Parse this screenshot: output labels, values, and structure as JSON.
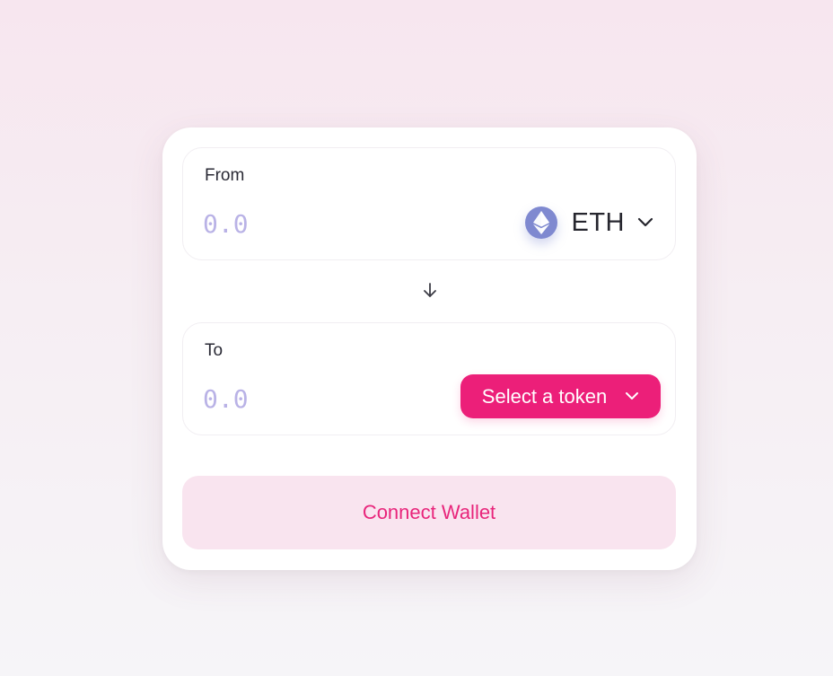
{
  "swap": {
    "from": {
      "label": "From",
      "amount_placeholder": "0.0",
      "amount_value": "",
      "token": {
        "symbol": "ETH",
        "icon": "ethereum-icon",
        "icon_color": "#7f89d0"
      }
    },
    "direction_icon": "arrow-down-icon",
    "to": {
      "label": "To",
      "amount_placeholder": "0.0",
      "amount_value": "",
      "select_token_label": "Select a token"
    },
    "connect_wallet_label": "Connect Wallet"
  },
  "colors": {
    "accent": "#ec1f79",
    "accent_soft": "#f9e4ef",
    "placeholder": "#b9b2e6",
    "text": "#26262e"
  }
}
